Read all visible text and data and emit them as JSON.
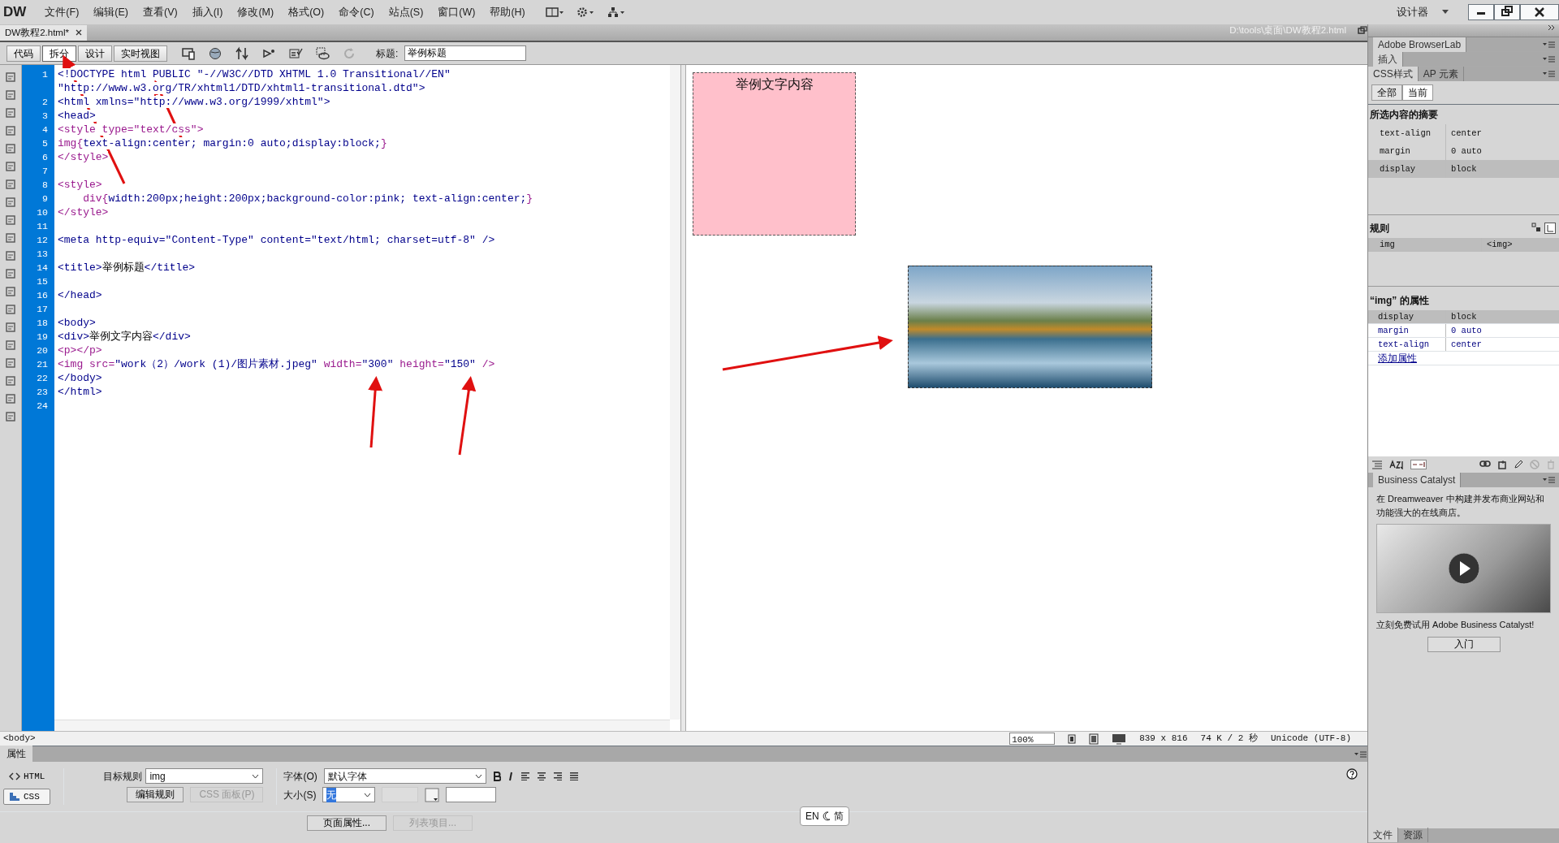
{
  "app": {
    "logo": "DW",
    "menus": [
      "文件(F)",
      "编辑(E)",
      "查看(V)",
      "插入(I)",
      "修改(M)",
      "格式(O)",
      "命令(C)",
      "站点(S)",
      "窗口(W)",
      "帮助(H)"
    ],
    "workspace": "设计器"
  },
  "document_tab": {
    "title": "DW教程2.html*",
    "path": "D:\\tools\\桌面\\DW教程2.html"
  },
  "view_buttons": [
    {
      "label": "代码",
      "selected": false
    },
    {
      "label": "拆分",
      "selected": true
    },
    {
      "label": "设计",
      "selected": false
    },
    {
      "label": "实时视图",
      "selected": false
    }
  ],
  "title_field": {
    "label": "标题:",
    "value": "举例标题"
  },
  "code_lines": [
    {
      "number": "1",
      "segments": [
        {
          "kind": "tag",
          "text": "<!DOCTYPE html PUBLIC \"-//W3C//DTD XHTML 1.0 Transitional//EN\""
        }
      ]
    },
    {
      "segments": [
        {
          "kind": "tag",
          "text": "\"http://www.w3.org/TR/xhtml1/DTD/xhtml1-transitional.dtd\">"
        }
      ]
    },
    {
      "number": "2",
      "segments": [
        {
          "kind": "tag",
          "text": "<html xmlns=\"http://www.w3.org/1999/xhtml\">"
        }
      ]
    },
    {
      "number": "3",
      "segments": [
        {
          "kind": "tag",
          "text": "<head>"
        }
      ]
    },
    {
      "number": "4",
      "segments": [
        {
          "kind": "style-tag",
          "text": "<style type=\"text/css\">"
        }
      ]
    },
    {
      "number": "5",
      "segments": [
        {
          "kind": "style-tag",
          "text": "img{"
        },
        {
          "kind": "css",
          "text": "text-align:center; margin:0 auto;display:block;"
        },
        {
          "kind": "style-tag",
          "text": "}"
        }
      ]
    },
    {
      "number": "6",
      "segments": [
        {
          "kind": "style-tag",
          "text": "</style>"
        }
      ]
    },
    {
      "number": "7"
    },
    {
      "number": "8",
      "segments": [
        {
          "kind": "style-tag",
          "text": "<style>"
        }
      ]
    },
    {
      "number": "9",
      "segments": [
        {
          "kind": "style-tag",
          "text": "    div{"
        },
        {
          "kind": "css",
          "text": "width:200px;height:200px;background-color:pink; text-align:center;"
        },
        {
          "kind": "style-tag",
          "text": "}"
        }
      ]
    },
    {
      "number": "10",
      "segments": [
        {
          "kind": "style-tag",
          "text": "</style>"
        }
      ]
    },
    {
      "number": "11"
    },
    {
      "number": "12",
      "segments": [
        {
          "kind": "tag",
          "text": "<meta http-equiv=\"Content-Type\" content=\"text/html; charset=utf-8\" />"
        }
      ]
    },
    {
      "number": "13"
    },
    {
      "number": "14",
      "segments": [
        {
          "kind": "tag",
          "text": "<title>"
        },
        {
          "kind": "text",
          "text": "举例标题"
        },
        {
          "kind": "tag",
          "text": "</title>"
        }
      ]
    },
    {
      "number": "15"
    },
    {
      "number": "16",
      "segments": [
        {
          "kind": "tag",
          "text": "</head>"
        }
      ]
    },
    {
      "number": "17"
    },
    {
      "number": "18",
      "segments": [
        {
          "kind": "tag",
          "text": "<body>"
        }
      ]
    },
    {
      "number": "19",
      "segments": [
        {
          "kind": "tag",
          "text": "<div>"
        },
        {
          "kind": "text",
          "text": "举例文字内容"
        },
        {
          "kind": "tag",
          "text": "</div>"
        }
      ]
    },
    {
      "number": "20",
      "segments": [
        {
          "kind": "style-tag",
          "text": "<p></p>"
        }
      ]
    },
    {
      "number": "21",
      "segments": [
        {
          "kind": "style-tag",
          "text": "<img src="
        },
        {
          "kind": "tag",
          "text": "\"work（2）/work (1)/图片素材.jpeg\""
        },
        {
          "kind": "style-tag",
          "text": " width="
        },
        {
          "kind": "tag",
          "text": "\"300\""
        },
        {
          "kind": "style-tag",
          "text": " height="
        },
        {
          "kind": "tag",
          "text": "\"150\""
        },
        {
          "kind": "style-tag",
          "text": " />"
        }
      ]
    },
    {
      "number": "22",
      "segments": [
        {
          "kind": "tag",
          "text": "</body>"
        }
      ]
    },
    {
      "number": "23",
      "segments": [
        {
          "kind": "tag",
          "text": "</html>"
        }
      ]
    },
    {
      "number": "24"
    }
  ],
  "design_view": {
    "div_text": "举例文字内容"
  },
  "status_bar": {
    "tag": "<body>",
    "zoom": "100%",
    "window_size": "839 x 816",
    "download": "74 K / 2 秒",
    "encoding": "Unicode (UTF-8)"
  },
  "properties": {
    "tab": "属性",
    "modes": [
      {
        "label": "HTML",
        "selected": false
      },
      {
        "label": "CSS",
        "selected": true
      }
    ],
    "target_rule_label": "目标规则",
    "target_rule": "img",
    "buttons": [
      {
        "label": "编辑规则",
        "disabled": false
      },
      {
        "label": "CSS 面板(P)",
        "disabled": true
      }
    ],
    "font_label": "字体(O)",
    "font": "默认字体",
    "size_label": "大小(S)",
    "size": "无",
    "bottom_buttons": [
      {
        "label": "页面属性...",
        "disabled": false
      },
      {
        "label": "列表项目...",
        "disabled": true
      }
    ]
  },
  "panels": {
    "browserlab": "Adobe BrowserLab",
    "insert": "插入",
    "css_tabs": [
      {
        "label": "CSS样式",
        "selected": true
      },
      {
        "label": "AP 元素",
        "selected": false
      }
    ],
    "mode_buttons": [
      {
        "label": "全部",
        "selected": false
      },
      {
        "label": "当前",
        "selected": true
      }
    ],
    "summary_title": "所选内容的摘要",
    "summary_rows": [
      {
        "property": "text-align",
        "value": "center",
        "selected": false
      },
      {
        "property": "margin",
        "value": "0 auto",
        "selected": false
      },
      {
        "property": "display",
        "value": "block",
        "selected": true
      }
    ],
    "rules_title": "规则",
    "rules": [
      {
        "selector": "img",
        "tag": "<img>",
        "selected": true
      }
    ],
    "props_title": "“img” 的属性",
    "props": [
      {
        "property": "display",
        "value": "block",
        "selected": true
      },
      {
        "property": "margin",
        "value": "0 auto",
        "selected": false
      },
      {
        "property": "text-align",
        "value": "center",
        "selected": false
      }
    ],
    "add_property": "添加属性",
    "catalyst": {
      "title": "Business Catalyst",
      "intro": "在 Dreamweaver 中构建并发布商业网站和功能强大的在线商店。",
      "promo": "立刻免费试用 Adobe Business Catalyst!",
      "button": "入门"
    },
    "bottom_tabs": [
      {
        "label": "文件",
        "selected": true
      },
      {
        "label": "资源",
        "selected": false
      }
    ]
  },
  "ime": {
    "mode": "EN",
    "script": "简"
  }
}
